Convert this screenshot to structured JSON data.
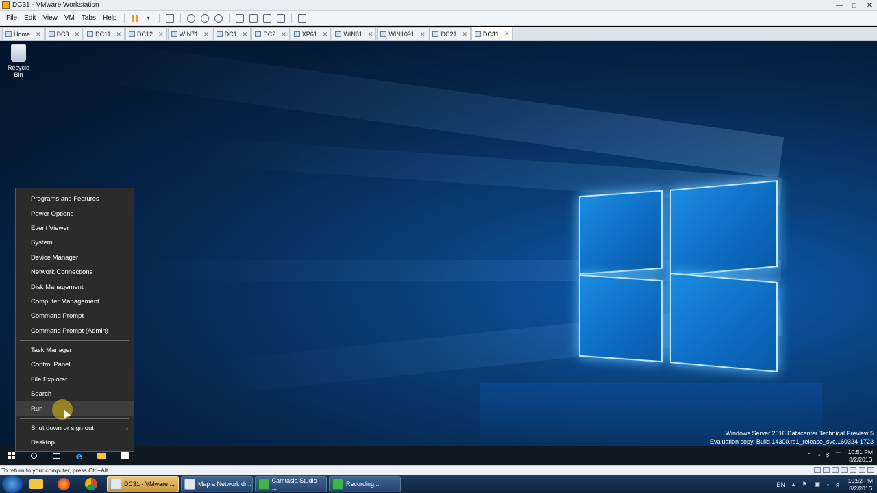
{
  "window": {
    "title": "DC31 - VMware Workstation"
  },
  "menu": [
    "File",
    "Edit",
    "View",
    "VM",
    "Tabs",
    "Help"
  ],
  "tabs": [
    {
      "label": "Home",
      "active": false
    },
    {
      "label": "DC3",
      "active": false
    },
    {
      "label": "DC11",
      "active": false
    },
    {
      "label": "DC12",
      "active": false
    },
    {
      "label": "WIN71",
      "active": false
    },
    {
      "label": "DC1",
      "active": false
    },
    {
      "label": "DC2",
      "active": false
    },
    {
      "label": "XP61",
      "active": false
    },
    {
      "label": "WIN81",
      "active": false
    },
    {
      "label": "WIN1091",
      "active": false
    },
    {
      "label": "DC21",
      "active": false
    },
    {
      "label": "DC31",
      "active": true
    }
  ],
  "desktop": {
    "recycle_bin_label": "Recycle Bin",
    "watermark_line1": "Windows Server 2016 Datacenter Technical Preview 5",
    "watermark_line2": "Evaluation copy. Build 14300.rs1_release_svc.160324-1723"
  },
  "winx_menu": {
    "group1": [
      "Programs and Features",
      "Power Options",
      "Event Viewer",
      "System",
      "Device Manager",
      "Network Connections",
      "Disk Management",
      "Computer Management",
      "Command Prompt",
      "Command Prompt (Admin)"
    ],
    "group2": [
      "Task Manager",
      "Control Panel",
      "File Explorer",
      "Search",
      "Run"
    ],
    "group3": [
      "Shut down or sign out",
      "Desktop"
    ],
    "highlighted": "Run"
  },
  "guest_tray": {
    "lang": "",
    "time": "10:51 PM",
    "date": "8/2/2016"
  },
  "status_bar": {
    "text": "To return to your computer, press Ctrl+Alt."
  },
  "host_taskbar": {
    "buttons": [
      {
        "label": "DC31 - VMware ...",
        "active": true
      },
      {
        "label": "Map a Network dr...",
        "active": false
      },
      {
        "label": "Camtasia Studio - ...",
        "active": false
      },
      {
        "label": "Recording...",
        "active": false
      }
    ],
    "lang": "EN",
    "time": "10:52 PM",
    "date": "8/2/2016"
  },
  "colors": {
    "menu_bg": "#2b2b2b",
    "desktop_blue": "#0a3f7a",
    "active_host_btn": "#e9c77a"
  }
}
